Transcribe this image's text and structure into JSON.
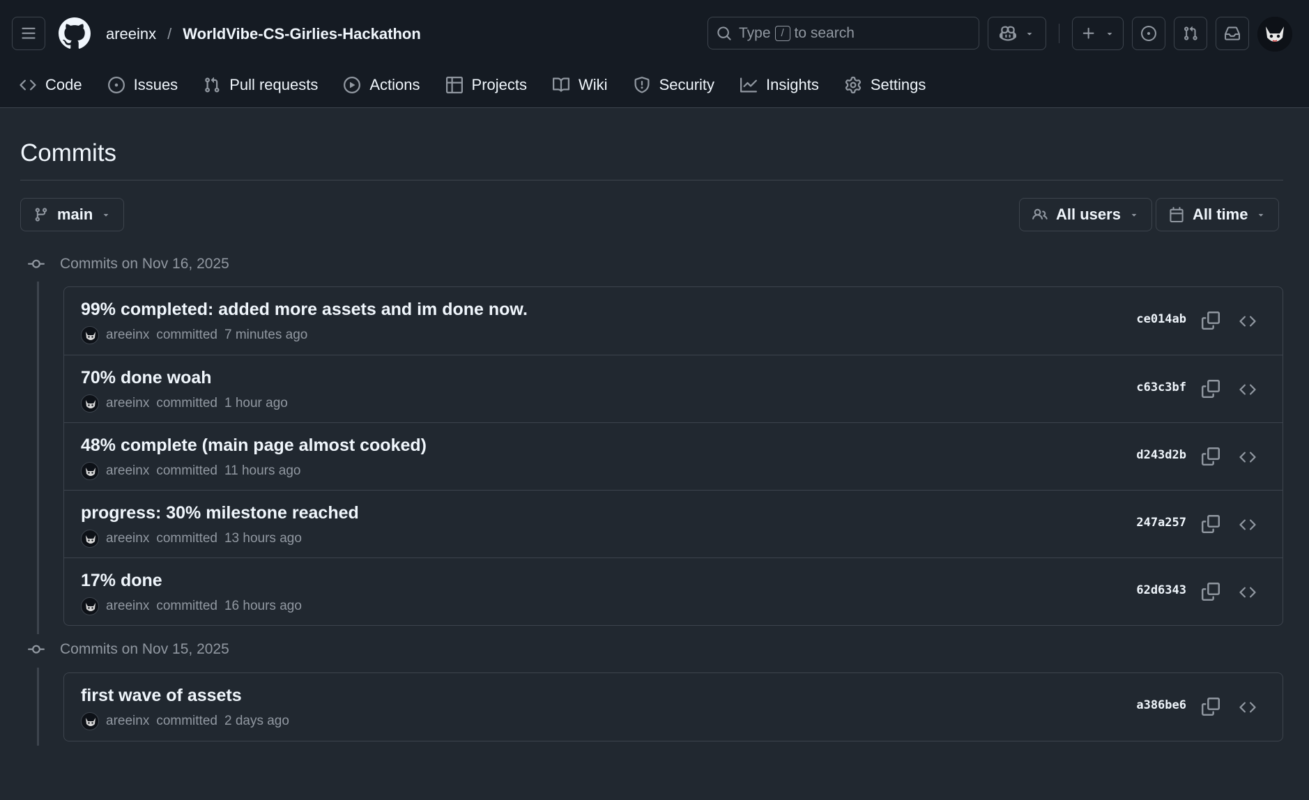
{
  "header": {
    "owner": "areeinx",
    "separator": "/",
    "repo": "WorldVibe-CS-Girlies-Hackathon",
    "search": {
      "prefix": "Type",
      "key": "/",
      "suffix": "to search"
    }
  },
  "nav": {
    "items": [
      {
        "label": "Code",
        "icon": "code-icon"
      },
      {
        "label": "Issues",
        "icon": "issue-icon"
      },
      {
        "label": "Pull requests",
        "icon": "pull-request-icon"
      },
      {
        "label": "Actions",
        "icon": "play-icon"
      },
      {
        "label": "Projects",
        "icon": "table-icon"
      },
      {
        "label": "Wiki",
        "icon": "book-icon"
      },
      {
        "label": "Security",
        "icon": "shield-icon"
      },
      {
        "label": "Insights",
        "icon": "graph-icon"
      },
      {
        "label": "Settings",
        "icon": "gear-icon"
      }
    ]
  },
  "page": {
    "title": "Commits"
  },
  "filters": {
    "branch": "main",
    "users": "All users",
    "time": "All time"
  },
  "groups": [
    {
      "heading": "Commits on Nov 16, 2025",
      "commits": [
        {
          "message": "99% completed: added more assets and im done now.",
          "author": "areeinx",
          "verb": "committed",
          "time": "7 minutes ago",
          "sha": "ce014ab"
        },
        {
          "message": "70% done woah",
          "author": "areeinx",
          "verb": "committed",
          "time": "1 hour ago",
          "sha": "c63c3bf"
        },
        {
          "message": "48% complete (main page almost cooked)",
          "author": "areeinx",
          "verb": "committed",
          "time": "11 hours ago",
          "sha": "d243d2b"
        },
        {
          "message": "progress: 30% milestone reached",
          "author": "areeinx",
          "verb": "committed",
          "time": "13 hours ago",
          "sha": "247a257"
        },
        {
          "message": "17% done",
          "author": "areeinx",
          "verb": "committed",
          "time": "16 hours ago",
          "sha": "62d6343"
        }
      ]
    },
    {
      "heading": "Commits on Nov 15, 2025",
      "commits": [
        {
          "message": "first wave of assets",
          "author": "areeinx",
          "verb": "committed",
          "time": "2 days ago",
          "sha": "a386be6"
        }
      ]
    }
  ],
  "colors": {
    "background": "#212830",
    "header": "#151b23",
    "border": "#3d444d",
    "text": "#f0f6fc",
    "muted": "#9198a1"
  }
}
